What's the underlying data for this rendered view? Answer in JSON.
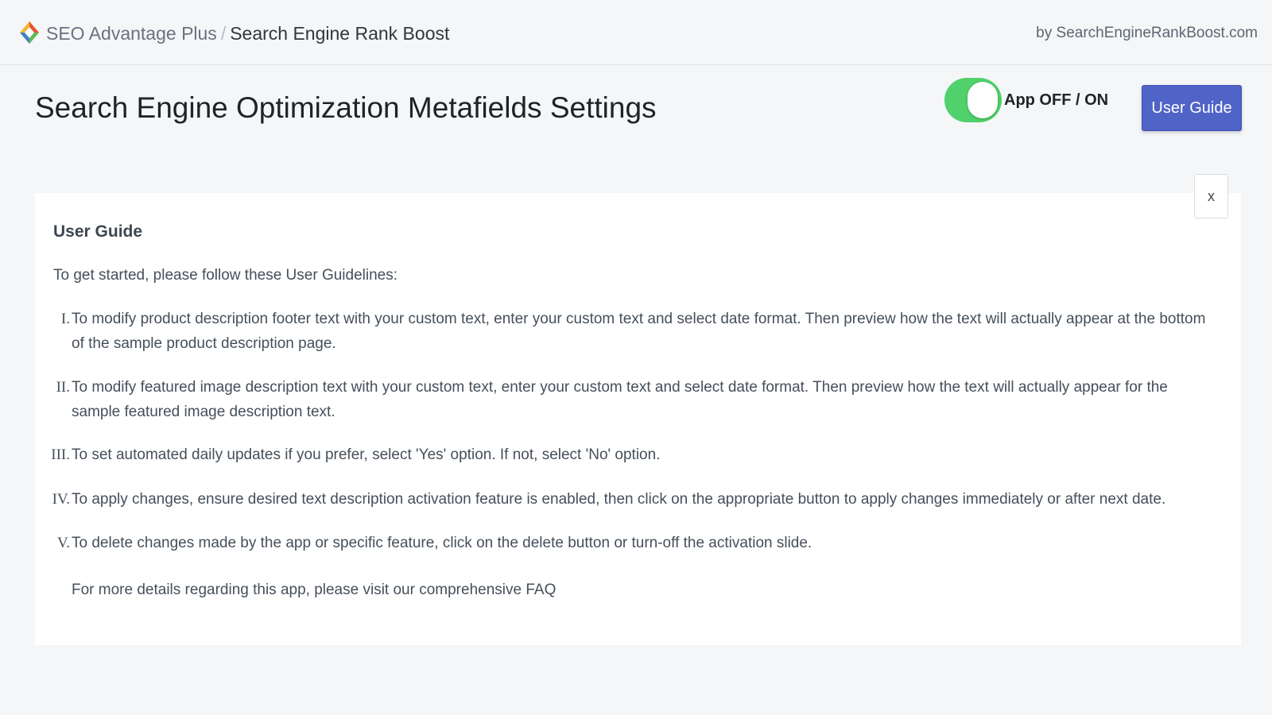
{
  "header": {
    "app_name": "SEO Advantage Plus",
    "separator": "/",
    "current_page": "Search Engine Rank Boost",
    "byline": "by SearchEngineRankBoost.com",
    "logo_icon": "diamond-logo-icon"
  },
  "main": {
    "title": "Search Engine Optimization Metafields Settings",
    "toggle": {
      "label": "App OFF / ON",
      "state": "on",
      "color": "#50d16b"
    },
    "user_guide_button": "User Guide",
    "accent_color": "#5063c6"
  },
  "guide": {
    "close_label": "x",
    "heading": "User Guide",
    "intro": "To get started, please follow these User Guidelines:",
    "steps": [
      {
        "num": "I.",
        "text": "To modify product description footer text with your custom text, enter your custom text and select date format. Then preview how the text will actually appear at the bottom of the sample product description page."
      },
      {
        "num": "II.",
        "text": "To modify featured image description text with your custom text, enter your custom text and select date format. Then preview how the text will actually appear for the sample featured image description text."
      },
      {
        "num": "III.",
        "text": "To set automated daily updates if you prefer, select 'Yes' option. If not, select 'No' option."
      },
      {
        "num": "IV.",
        "text": "To apply changes, ensure desired text description activation feature is enabled, then click on the appropriate button to apply changes immediately or after next date."
      },
      {
        "num": "V.",
        "text": "To delete changes made by the app or specific feature, click on the delete button or turn-off the activation slide."
      }
    ],
    "footer_note": "For more details regarding this app, please visit our comprehensive FAQ"
  }
}
